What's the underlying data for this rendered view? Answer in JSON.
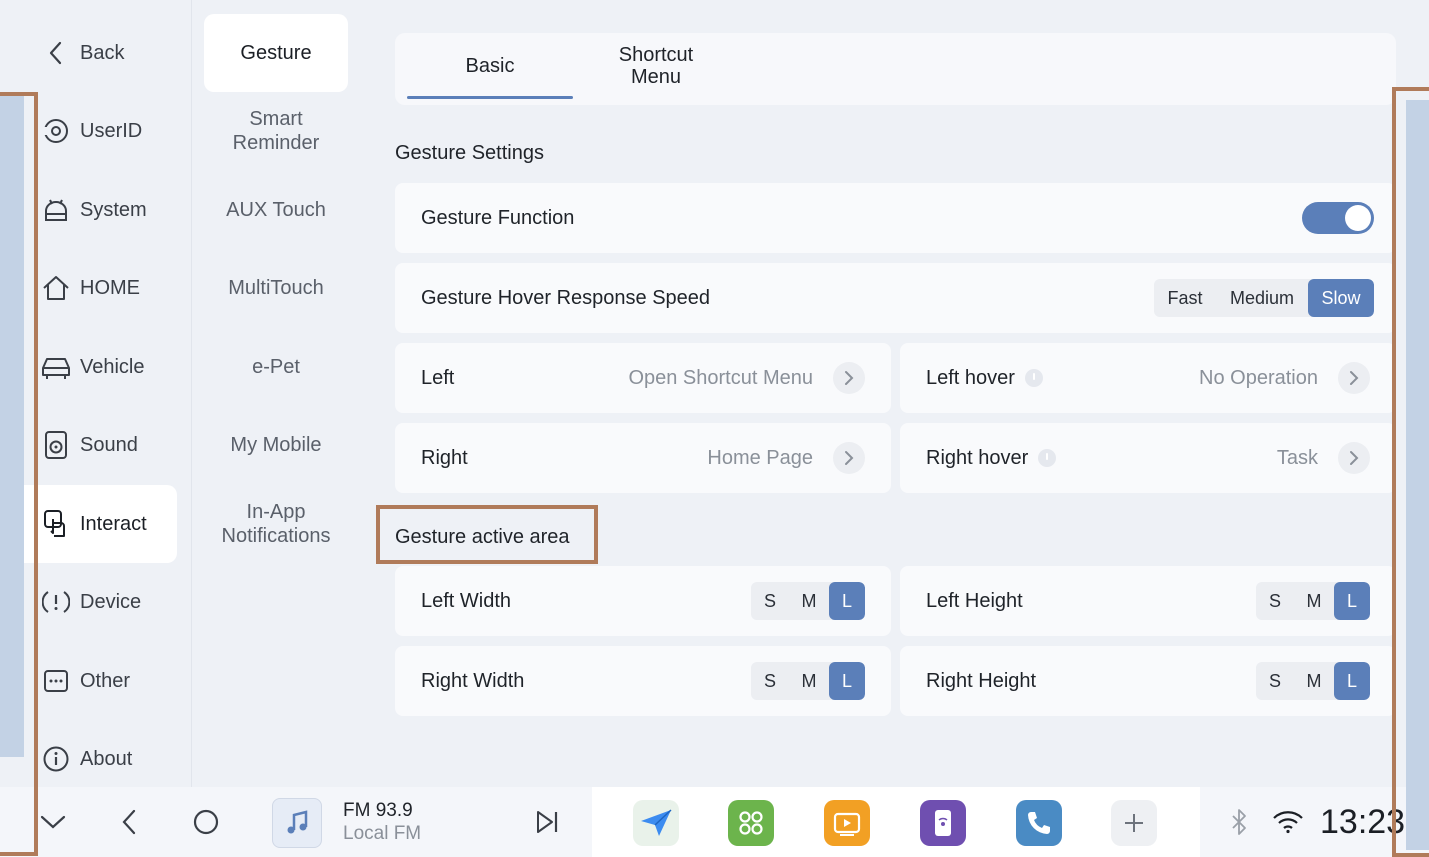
{
  "nav": {
    "items": [
      {
        "label": "Back",
        "icon": "chevron-left-icon"
      },
      {
        "label": "UserID",
        "icon": "user-id-icon"
      },
      {
        "label": "System",
        "icon": "android-icon"
      },
      {
        "label": "HOME",
        "icon": "home-icon"
      },
      {
        "label": "Vehicle",
        "icon": "car-icon"
      },
      {
        "label": "Sound",
        "icon": "speaker-icon"
      },
      {
        "label": "Interact",
        "icon": "touch-hand-icon"
      },
      {
        "label": "Device",
        "icon": "device-alert-icon"
      },
      {
        "label": "Other",
        "icon": "more-box-icon"
      },
      {
        "label": "About",
        "icon": "info-icon"
      }
    ],
    "active": "Interact"
  },
  "subnav": {
    "items": [
      {
        "label": "Gesture"
      },
      {
        "label": "Smart\nReminder"
      },
      {
        "label": "AUX Touch"
      },
      {
        "label": "MultiTouch"
      },
      {
        "label": "e-Pet"
      },
      {
        "label": "My Mobile"
      },
      {
        "label": "In-App\nNotifications"
      }
    ],
    "active": "Gesture"
  },
  "tabs": [
    {
      "label": "Basic",
      "active": true
    },
    {
      "label": "Shortcut\nMenu",
      "active": false
    }
  ],
  "gesture_settings": {
    "title": "Gesture Settings",
    "function_label": "Gesture Function",
    "function_on": true,
    "speed_label": "Gesture Hover Response Speed",
    "speed_options": [
      "Fast",
      "Medium",
      "Slow"
    ],
    "speed_selected": "Slow",
    "left": {
      "label": "Left",
      "value": "Open Shortcut Menu"
    },
    "right": {
      "label": "Right",
      "value": "Home Page"
    },
    "left_hover": {
      "label": "Left hover",
      "value": "No Operation"
    },
    "right_hover": {
      "label": "Right hover",
      "value": "Task"
    }
  },
  "active_area": {
    "title": "Gesture active area",
    "size_options": [
      "S",
      "M",
      "L"
    ],
    "left_width": {
      "label": "Left Width",
      "selected": "L"
    },
    "left_height": {
      "label": "Left Height",
      "selected": "L"
    },
    "right_width": {
      "label": "Right Width",
      "selected": "L"
    },
    "right_height": {
      "label": "Right Height",
      "selected": "L"
    }
  },
  "dock": {
    "media_title": "FM 93.9",
    "media_sub": "Local FM",
    "clock": "13:23",
    "apps": [
      "navigation-icon",
      "apps-grid-icon",
      "video-icon",
      "phone-mirror-icon",
      "phone-icon",
      "add-icon"
    ]
  },
  "colors": {
    "accent": "#5b7fb9",
    "highlight": "#b07b5a",
    "strip": "#c3d2e5"
  }
}
